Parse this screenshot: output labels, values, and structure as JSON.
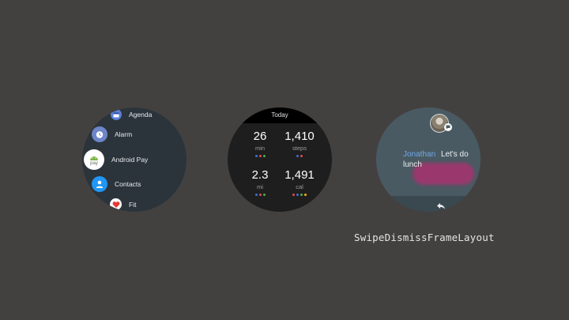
{
  "launcher": {
    "items": [
      {
        "label": "Agenda",
        "icon": "calendar-icon",
        "color": "#5b7fd6"
      },
      {
        "label": "Alarm",
        "icon": "alarm-clock-icon",
        "color": "#6d86c9"
      },
      {
        "label": "Android Pay",
        "icon": "android-pay-icon",
        "color": "#ffffff",
        "icon_text": "pay"
      },
      {
        "label": "Contacts",
        "icon": "contact-person-icon",
        "color": "#2196f3"
      },
      {
        "label": "Fit",
        "icon": "fit-heart-icon",
        "color": "#ffffff"
      }
    ]
  },
  "fit": {
    "header": "Today",
    "stats": [
      {
        "value": "26",
        "unit": "min",
        "dots": [
          "#3f6fd8",
          "#e24a4a",
          "#4bb04f"
        ]
      },
      {
        "value": "1,410",
        "unit": "steps",
        "dots": [
          "#3f6fd8",
          "#e24a4a"
        ]
      },
      {
        "value": "2.3",
        "unit": "mi",
        "dots": [
          "#3f6fd8",
          "#e24a4a",
          "#4bb04f"
        ]
      },
      {
        "value": "1,491",
        "unit": "cal",
        "dots": [
          "#e24a4a",
          "#3f6fd8",
          "#4bb04f",
          "#f4b400"
        ]
      }
    ]
  },
  "message": {
    "sender": "Jonathan",
    "text_line1": "Let's do",
    "text_line2": "lunch",
    "sender_color": "#6fa8e6",
    "ripple_color": "#a8336f",
    "reply_icon": "reply-arrow-icon"
  },
  "caption": "SwipeDismissFrameLayout"
}
